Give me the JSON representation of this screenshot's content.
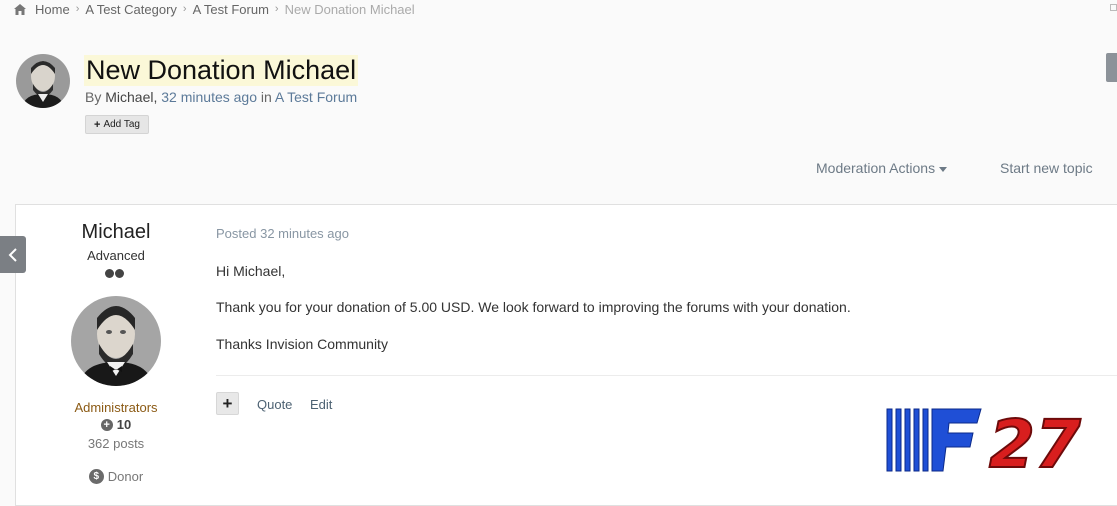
{
  "breadcrumb": {
    "home": "Home",
    "category": "A Test Category",
    "forum": "A Test Forum",
    "current": "New Donation Michael"
  },
  "topic": {
    "title": "New Donation Michael",
    "by_prefix": "By",
    "author": "Michael,",
    "time": "32 minutes ago",
    "in_text": "in",
    "forum_link": "A Test Forum",
    "add_tag": "Add Tag"
  },
  "actions": {
    "moderation": "Moderation Actions",
    "start_topic": "Start new topic"
  },
  "post": {
    "author_name": "Michael",
    "rank": "Advanced",
    "group": "Administrators",
    "reputation": "10",
    "posts": "362 posts",
    "badge": "Donor",
    "posted": "Posted 32 minutes ago",
    "greeting": "Hi Michael,",
    "body": "Thank you for your donation of 5.00 USD. We look forward to improving the forums with your donation.",
    "signoff": "Thanks Invision Community",
    "multiquote": "+",
    "quote": "Quote",
    "edit": "Edit"
  },
  "watermark": {
    "text": "F27"
  },
  "colors": {
    "link": "#5c7a99",
    "group": "#8b5a14",
    "title_highlight": "#fbf8d8",
    "watermark_blue": "#1f4fd6",
    "watermark_red": "#d81e1e"
  }
}
